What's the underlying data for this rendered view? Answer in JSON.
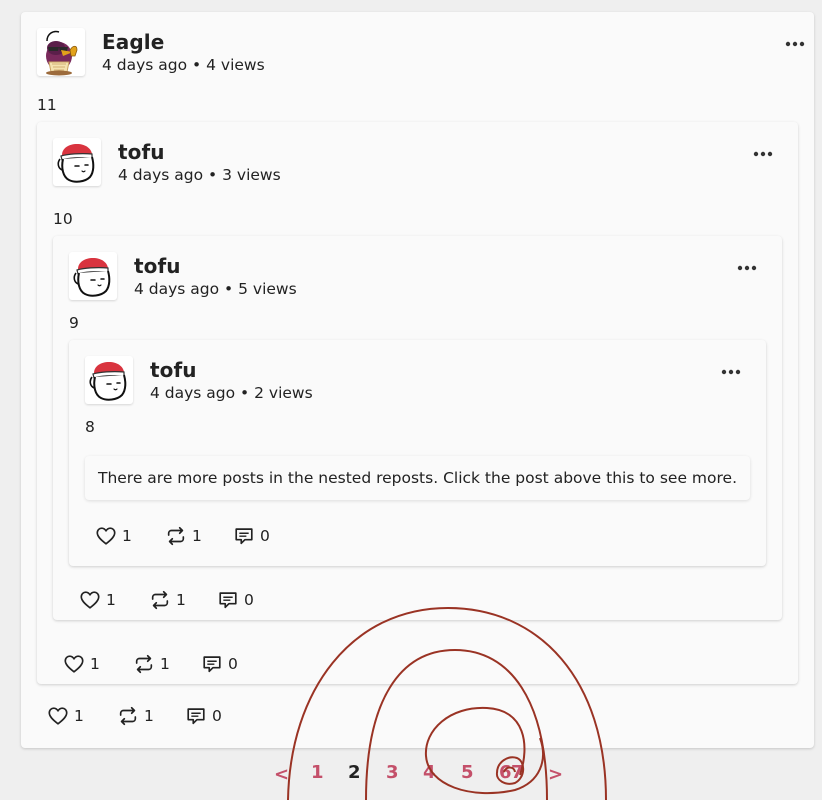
{
  "posts": [
    {
      "username": "Eagle",
      "meta": "4 days ago • 4 views",
      "text": "11",
      "likes": "1",
      "reposts": "1",
      "comments": "0"
    },
    {
      "username": "tofu",
      "meta": "4 days ago • 3 views",
      "text": "10",
      "likes": "1",
      "reposts": "1",
      "comments": "0"
    },
    {
      "username": "tofu",
      "meta": "4 days ago • 5 views",
      "text": "9",
      "likes": "1",
      "reposts": "1",
      "comments": "0"
    },
    {
      "username": "tofu",
      "meta": "4 days ago • 2 views",
      "text": "8",
      "likes": "1",
      "reposts": "1",
      "comments": "0"
    }
  ],
  "notice": "There are more posts in the nested reposts. Click the post above this to see more.",
  "pagination": {
    "prev": "<",
    "pages": [
      "1",
      "2",
      "3",
      "4",
      "5",
      "6",
      "7"
    ],
    "current": "2",
    "next": ">"
  },
  "icons": {
    "like": "heart-icon",
    "repost": "repost-icon",
    "comment": "comment-icon",
    "more": "more-options-icon"
  },
  "colors": {
    "page_background": "#efefef",
    "card_background": "#fafafa",
    "pagination_link": "#c4506a",
    "pagination_current": "#222222",
    "scribble": "#9a3324"
  }
}
